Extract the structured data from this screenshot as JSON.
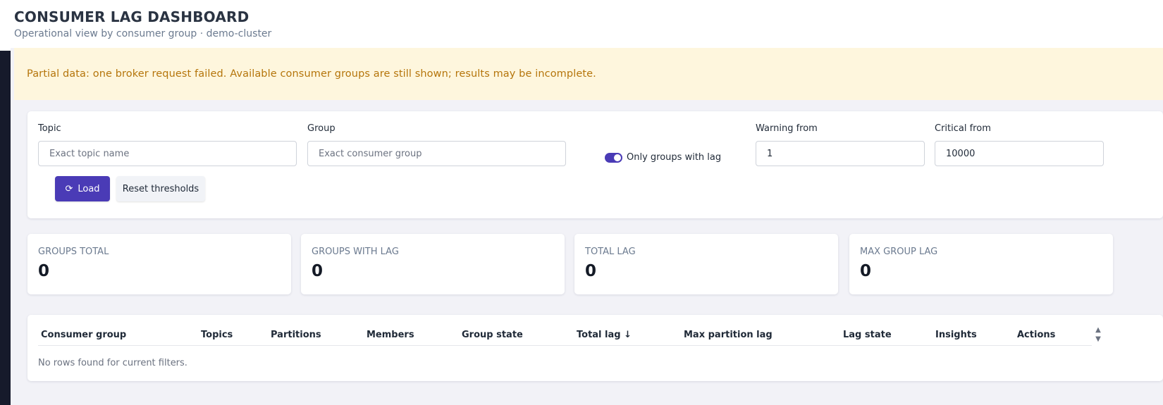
{
  "header": {
    "title": "CONSUMER LAG DASHBOARD",
    "subtitle": "Operational view by consumer group · demo-cluster"
  },
  "alert": {
    "text": "Partial data: one broker request failed. Available consumer groups are still shown; results may be incomplete.",
    "color": "#b5750b"
  },
  "filters": {
    "topic_label": "Topic",
    "topic_placeholder": "Exact topic name",
    "group_label": "Group",
    "group_placeholder": "Exact consumer group",
    "only_lag_label": "Only groups with lag",
    "only_lag_checked": true,
    "warning_label": "Warning from",
    "warning_value": "1",
    "critical_label": "Critical from",
    "critical_value": "10000",
    "load_label": "Load",
    "load_icon": "refresh-icon",
    "reset_label": "Reset thresholds"
  },
  "stats": [
    {
      "label": "GROUPS TOTAL",
      "value": "0"
    },
    {
      "label": "GROUPS WITH LAG",
      "value": "0"
    },
    {
      "label": "TOTAL LAG",
      "value": "0"
    },
    {
      "label": "MAX GROUP LAG",
      "value": "0"
    }
  ],
  "table": {
    "columns": [
      "Consumer group",
      "Topics",
      "Partitions",
      "Members",
      "Group state",
      "Total lag ↓",
      "Max partition lag",
      "Lag state",
      "Insights",
      "Actions"
    ],
    "sorted_column": "Total lag",
    "sort_direction": "desc",
    "empty_text": "No rows found for current filters."
  },
  "colors": {
    "accent": "#4a3bb6",
    "sidebar": "#161a2b",
    "alert_bg": "#fef6dd"
  }
}
